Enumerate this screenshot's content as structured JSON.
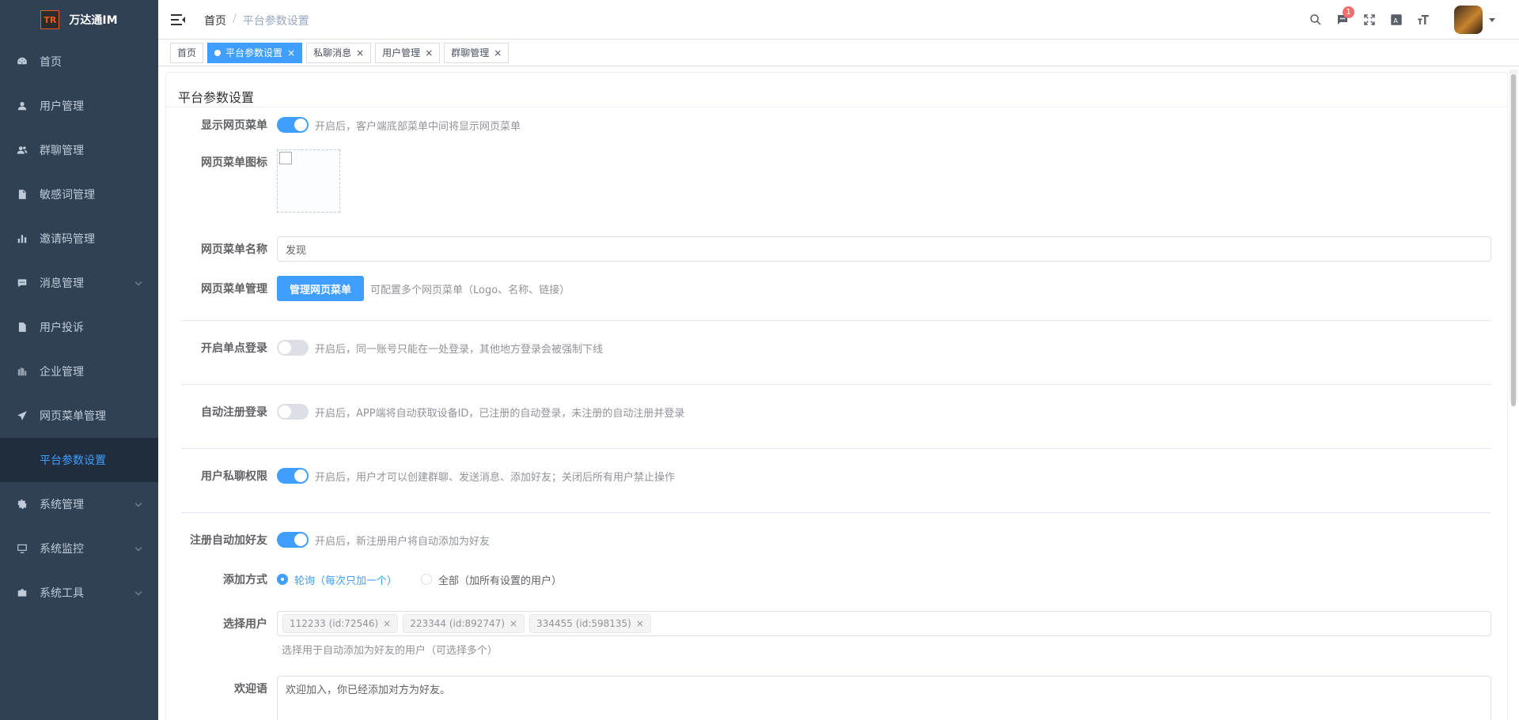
{
  "app": {
    "name": "万达通IM",
    "logo_text": "TR"
  },
  "sidebar": {
    "items": [
      {
        "label": "首页",
        "icon": "dashboard-icon"
      },
      {
        "label": "用户管理",
        "icon": "user-icon"
      },
      {
        "label": "群聊管理",
        "icon": "peoples-icon"
      },
      {
        "label": "敏感词管理",
        "icon": "documentation-icon"
      },
      {
        "label": "邀请码管理",
        "icon": "chart-icon"
      },
      {
        "label": "消息管理",
        "icon": "message-icon",
        "expandable": true
      },
      {
        "label": "用户投诉",
        "icon": "form-icon"
      },
      {
        "label": "企业管理",
        "icon": "company-icon"
      },
      {
        "label": "网页菜单管理",
        "icon": "send-icon"
      },
      {
        "label": "平台参数设置",
        "icon": "",
        "active": true
      },
      {
        "label": "系统管理",
        "icon": "system-icon",
        "expandable": true
      },
      {
        "label": "系统监控",
        "icon": "monitor-icon",
        "expandable": true
      },
      {
        "label": "系统工具",
        "icon": "tool-icon",
        "expandable": true
      }
    ]
  },
  "header": {
    "breadcrumb": [
      "首页",
      "平台参数设置"
    ],
    "badge_count": "1"
  },
  "tabs": [
    {
      "label": "首页",
      "active": false,
      "closable": false
    },
    {
      "label": "平台参数设置",
      "active": true,
      "closable": true
    },
    {
      "label": "私聊消息",
      "active": false,
      "closable": true
    },
    {
      "label": "用户管理",
      "active": false,
      "closable": true
    },
    {
      "label": "群聊管理",
      "active": false,
      "closable": true
    }
  ],
  "card": {
    "title": "平台参数设置"
  },
  "form": {
    "show_web_menu": {
      "label": "显示网页菜单",
      "on": true,
      "hint": "开启后，客户端底部菜单中间将显示网页菜单"
    },
    "web_menu_icon": {
      "label": "网页菜单图标"
    },
    "web_menu_name": {
      "label": "网页菜单名称",
      "value": "发现"
    },
    "web_menu_manage": {
      "label": "网页菜单管理",
      "button": "管理网页菜单",
      "hint": "可配置多个网页菜单（Logo、名称、链接）"
    },
    "single_login": {
      "label": "开启单点登录",
      "on": false,
      "hint": "开启后，同一账号只能在一处登录，其他地方登录会被强制下线"
    },
    "auto_register": {
      "label": "自动注册登录",
      "on": false,
      "hint": "开启后，APP端将自动获取设备ID，已注册的自动登录，未注册的自动注册并登录"
    },
    "private_chat": {
      "label": "用户私聊权限",
      "on": true,
      "hint": "开启后，用户才可以创建群聊、发送消息、添加好友；关闭后所有用户禁止操作"
    },
    "auto_friend": {
      "label": "注册自动加好友",
      "on": true,
      "hint": "开启后，新注册用户将自动添加为好友"
    },
    "add_mode": {
      "label": "添加方式",
      "options": [
        "轮询（每次只加一个）",
        "全部（加所有设置的用户）"
      ],
      "selected": 0
    },
    "select_users": {
      "label": "选择用户",
      "chips": [
        "112233 (id:72546)",
        "223344 (id:892747)",
        "334455 (id:598135)"
      ],
      "hint": "选择用于自动添加为好友的用户（可选择多个）"
    },
    "welcome": {
      "label": "欢迎语",
      "value": "欢迎加入，你已经添加对方为好友。"
    }
  },
  "colors": {
    "sidebar_bg": "#304156",
    "primary": "#409eff",
    "badge": "#f56c6c"
  }
}
